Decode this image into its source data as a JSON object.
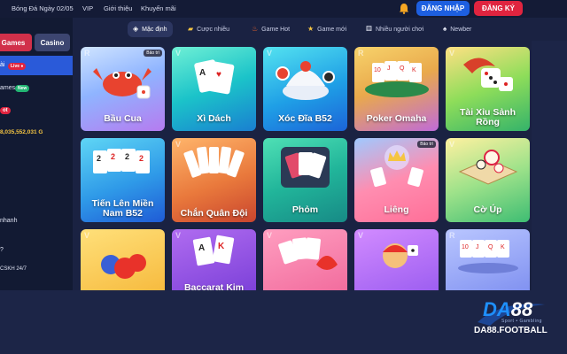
{
  "header": {
    "nav": [
      "Bóng Đá Ngày 02/05",
      "VIP",
      "Giới thiệu",
      "Khuyến mãi"
    ],
    "login_label": "ĐĂNG NHẬP",
    "register_label": "ĐĂNG KÝ"
  },
  "sidebar": {
    "tab_games": "Games",
    "tab_casino": "Casino",
    "active_item": "ài",
    "live_badge": "Live ●",
    "item_games": "ames",
    "new_badge": "New",
    "hot_badge": "ot",
    "balance": "8,035,552,031 G",
    "item_nhanh": "nhanh",
    "item_q": "?",
    "item_cskh": "CSKH 24/7"
  },
  "tabs": [
    {
      "label": "Mặc định",
      "icon": "grid-icon"
    },
    {
      "label": "Cược nhiều",
      "icon": "coins-icon"
    },
    {
      "label": "Game Hot",
      "icon": "fire-icon"
    },
    {
      "label": "Game mới",
      "icon": "star-icon"
    },
    {
      "label": "Nhiều người chơi",
      "icon": "dice-icon"
    },
    {
      "label": "Newber",
      "icon": "spade-icon"
    }
  ],
  "games": [
    {
      "title": "Bầu Cua",
      "corner": "R",
      "tag": "Bảo trì"
    },
    {
      "title": "Xì Dách",
      "corner": "V",
      "tag": ""
    },
    {
      "title": "Xóc Đĩa B52",
      "corner": "V",
      "tag": ""
    },
    {
      "title": "Poker Omaha",
      "corner": "R",
      "tag": ""
    },
    {
      "title": "Tài Xỉu Sảnh Rồng",
      "corner": "V",
      "tag": ""
    },
    {
      "title": "Tiến Lên Miền Nam B52",
      "corner": "",
      "tag": ""
    },
    {
      "title": "Chắn Quân Đội",
      "corner": "V",
      "tag": ""
    },
    {
      "title": "Phỏm",
      "corner": "",
      "tag": ""
    },
    {
      "title": "Liêng",
      "corner": "",
      "tag": "Bảo trì"
    },
    {
      "title": "Cờ Úp",
      "corner": "V",
      "tag": ""
    },
    {
      "title": "",
      "corner": "V",
      "tag": ""
    },
    {
      "title": "Baccarat Kim",
      "corner": "V",
      "tag": ""
    },
    {
      "title": "",
      "corner": "V",
      "tag": ""
    },
    {
      "title": "",
      "corner": "V",
      "tag": ""
    },
    {
      "title": "",
      "corner": "R",
      "tag": ""
    }
  ],
  "logo": {
    "main_da": "DA",
    "main_88": "88",
    "sub": "Sport • Gambling",
    "domain": "DA88.FOOTBALL"
  },
  "colors": {
    "background": "#1c2547",
    "login": "#1d5fe0",
    "register": "#e0243f",
    "active_sidebar": "#2a5ad9"
  }
}
